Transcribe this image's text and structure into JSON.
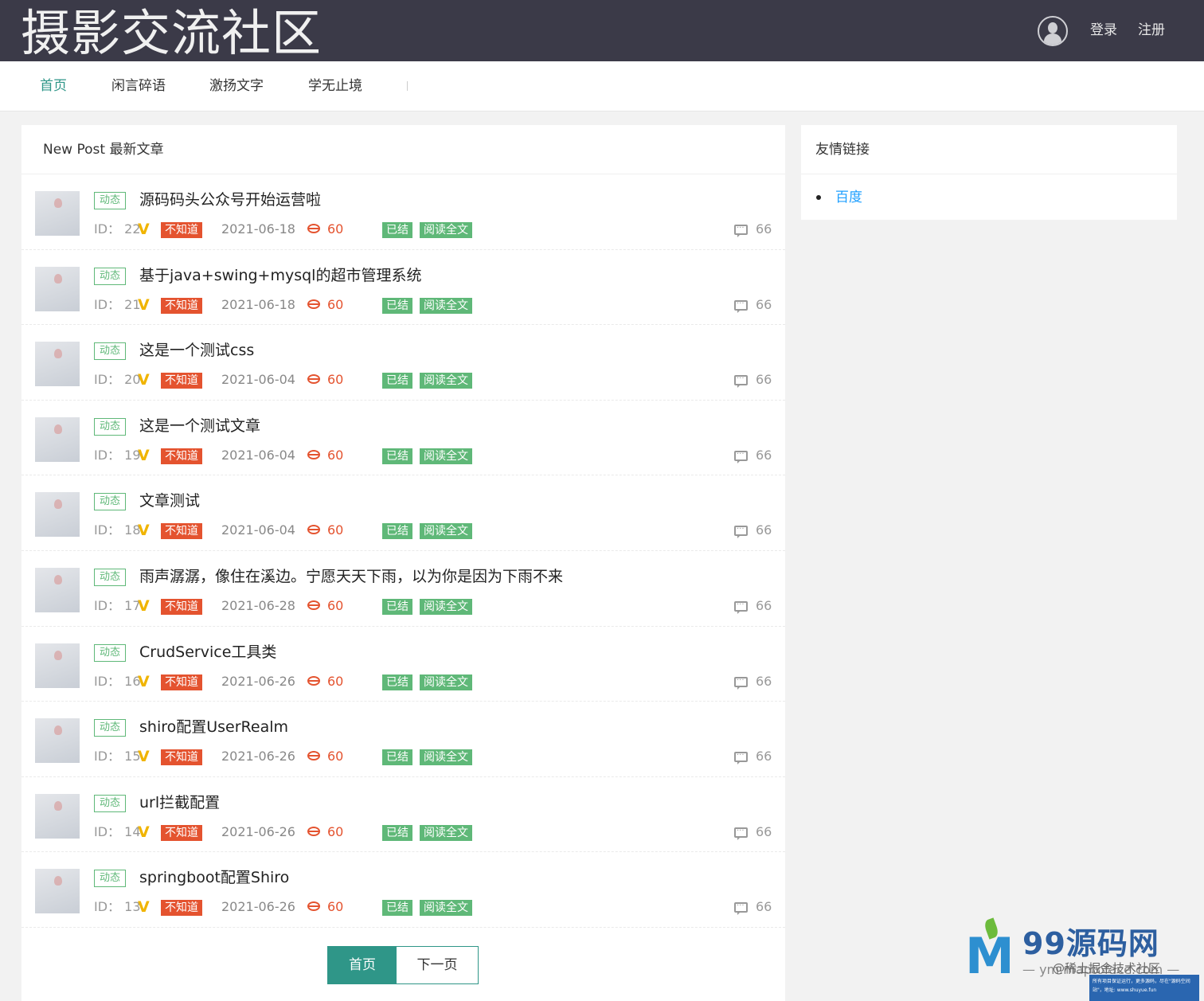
{
  "header": {
    "site_title": "摄影交流社区",
    "login_label": "登录",
    "register_label": "注册"
  },
  "nav": {
    "items": [
      {
        "label": "首页",
        "active": true
      },
      {
        "label": "闲言碎语",
        "active": false
      },
      {
        "label": "激扬文字",
        "active": false
      },
      {
        "label": "学无止境",
        "active": false
      }
    ]
  },
  "main": {
    "title": "New Post 最新文章",
    "id_prefix": "ID：",
    "tag_label": "动态",
    "badge_label": "不知道",
    "done_label": "已结",
    "read_label": "阅读全文",
    "posts": [
      {
        "title": "源码码头公众号开始运营啦",
        "id": "22",
        "date": "2021-06-18",
        "views": "60",
        "comments": "66"
      },
      {
        "title": "基于java+swing+mysql的超市管理系统",
        "id": "21",
        "date": "2021-06-18",
        "views": "60",
        "comments": "66"
      },
      {
        "title": "这是一个测试css",
        "id": "20",
        "date": "2021-06-04",
        "views": "60",
        "comments": "66"
      },
      {
        "title": "这是一个测试文章",
        "id": "19",
        "date": "2021-06-04",
        "views": "60",
        "comments": "66"
      },
      {
        "title": "文章测试",
        "id": "18",
        "date": "2021-06-04",
        "views": "60",
        "comments": "66"
      },
      {
        "title": "雨声潺潺，像住在溪边。宁愿天天下雨，以为你是因为下雨不来",
        "id": "17",
        "date": "2021-06-28",
        "views": "60",
        "comments": "66"
      },
      {
        "title": "CrudService工具类",
        "id": "16",
        "date": "2021-06-26",
        "views": "60",
        "comments": "66"
      },
      {
        "title": "shiro配置UserRealm",
        "id": "15",
        "date": "2021-06-26",
        "views": "60",
        "comments": "66"
      },
      {
        "title": "url拦截配置",
        "id": "14",
        "date": "2021-06-26",
        "views": "60",
        "comments": "66"
      },
      {
        "title": "springboot配置Shiro",
        "id": "13",
        "date": "2021-06-26",
        "views": "60",
        "comments": "66"
      }
    ],
    "pager": {
      "first_label": "首页",
      "next_label": "下一页"
    }
  },
  "sidebar": {
    "title": "友情链接",
    "links": [
      "百度"
    ]
  },
  "watermark": {
    "brand": "99源码网",
    "url": "— ym.maptoface.com —",
    "overlay": "@稀土掘金技术社区",
    "note": "所有项目保证运行，更多源码，尽在\"源码空间站\"，地址: www.shuyue.fun"
  },
  "colors": {
    "header_bg": "#3b3a48",
    "accent": "#2f9688",
    "tag_green": "#5fb878",
    "badge_red": "#e4532f",
    "link_blue": "#1e9fff"
  }
}
